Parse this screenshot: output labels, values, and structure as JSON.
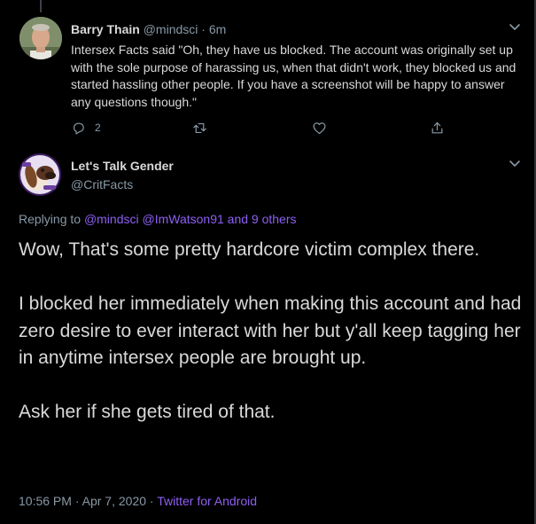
{
  "colors": {
    "background": "#000000",
    "primary_text": "#d9d9d9",
    "secondary_text": "#8899a6",
    "accent_link": "#8d5ff3",
    "divider": "#2f3336"
  },
  "reply_tweet": {
    "author_name": "Barry Thain",
    "author_handle": "@mindsci",
    "separator": "·",
    "time": "6m",
    "text": "Intersex Facts said \"Oh, they have us blocked. The account was originally set up with the sole purpose of harassing us, when that didn't work, they blocked us and started hassling other people. If you have a screenshot will be happy to answer any questions though.\"",
    "actions": {
      "reply_icon": "reply-icon",
      "reply_count": "2",
      "retweet_icon": "retweet-icon",
      "like_icon": "like-heart-icon",
      "share_icon": "share-icon"
    },
    "menu_icon": "chevron-down-icon"
  },
  "main_tweet": {
    "author_name": "Let's Talk Gender",
    "author_handle": "@CritFacts",
    "menu_icon": "chevron-down-icon",
    "replying_prefix": "Replying to",
    "replying_mention_1": "@mindsci",
    "replying_mention_2": "@ImWatson91",
    "replying_and": "and",
    "replying_others": "9 others",
    "body": {
      "p1": "Wow, That's some pretty hardcore victim complex there.",
      "p2": "I blocked her immediately when making this account and had zero desire to ever interact with her but y'all keep tagging her in anytime intersex people are brought up.",
      "p3": "Ask her if she gets tired of that."
    },
    "time": "10:56 PM",
    "meta_separator_1": "·",
    "date": "Apr 7, 2020",
    "meta_separator_2": "·",
    "source": "Twitter for Android"
  }
}
